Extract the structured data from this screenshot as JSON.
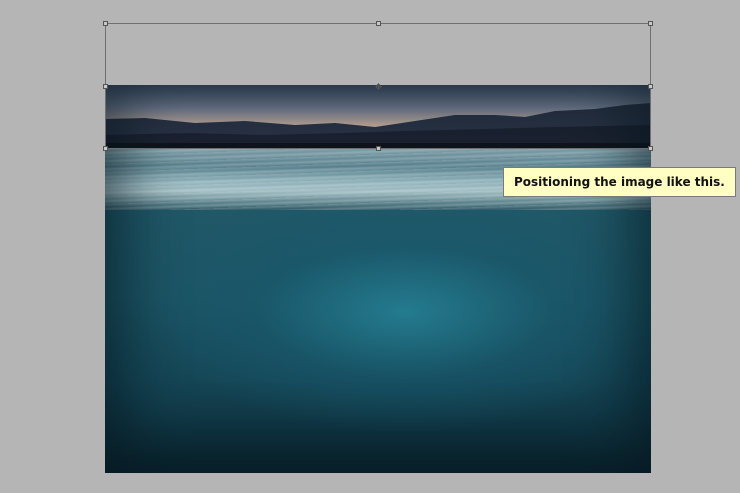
{
  "tooltip": {
    "text": "Positioning the image like this."
  },
  "colors": {
    "workspace_bg": "#b5b5b5",
    "tooltip_bg": "#ffffc4",
    "water_deep": "#1b4d5e"
  },
  "icons": {
    "center_point": "crosshair-icon",
    "transform_handle": "square-handle-icon"
  }
}
